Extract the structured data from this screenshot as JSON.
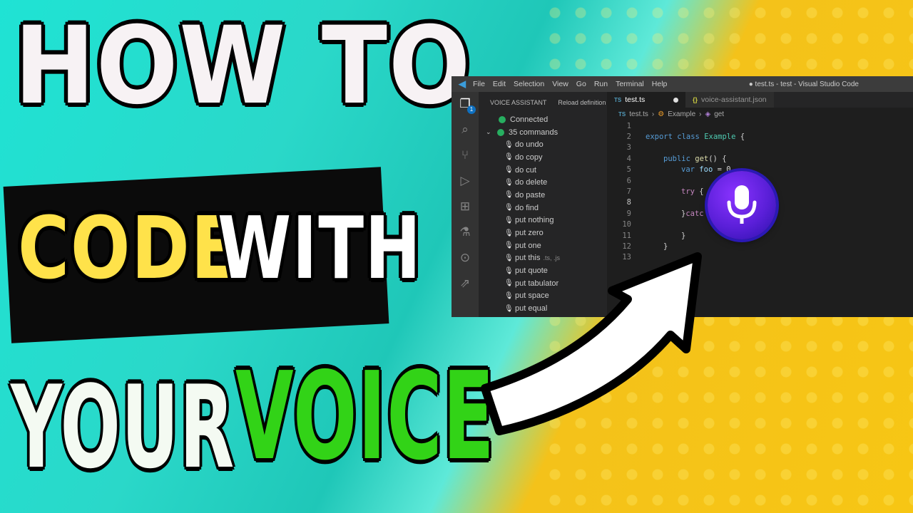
{
  "headline": {
    "line1": "HOW TO",
    "code": "CODE",
    "with": "WITH",
    "your": "YOUR",
    "voice": "VOICE"
  },
  "colors": {
    "teal": "#1fe3d4",
    "yellow": "#f7c614",
    "code_text": "#ffe24a",
    "voice_text": "#32d317",
    "mic_badge": "#6a24e6"
  },
  "vscode": {
    "menu": [
      "File",
      "Edit",
      "Selection",
      "View",
      "Go",
      "Run",
      "Terminal",
      "Help"
    ],
    "window_title": "● test.ts - test - Visual Studio Code",
    "sidebar": {
      "title": "VOICE ASSISTANT",
      "action": "Reload definition",
      "status": "Connected",
      "commands_count": "35 commands",
      "commands": [
        "do undo",
        "do copy",
        "do cut",
        "do delete",
        "do paste",
        "do find",
        "put nothing",
        "put zero",
        "put one",
        "put this",
        "put quote",
        "put tabulator",
        "put space",
        "put equal"
      ],
      "put_this_hint": ".ts, .js"
    },
    "tabs": [
      {
        "label": "test.ts",
        "icon": "TS"
      },
      {
        "label": "voice-assistant.json",
        "icon": "{}"
      }
    ],
    "breadcrumbs": [
      "test.ts",
      "Example",
      "get"
    ],
    "line_numbers": [
      "1",
      "2",
      "3",
      "4",
      "5",
      "6",
      "7",
      "8",
      "9",
      "10",
      "11",
      "12",
      "13"
    ],
    "code_lines": {
      "l2_kw": "export",
      "l2_kw2": "class",
      "l2_cls": "Example",
      "l2_brace": "{",
      "l4_kw": "public",
      "l4_fn": "get",
      "l4_rest": "() {",
      "l5_kw": "var",
      "l5_var": "foo",
      "l5_rest": "= 0",
      "l7_kw": "try",
      "l7_rest": "{",
      "l9_rest": "} ",
      "l9_kw": "catc",
      "l11": "}",
      "l12": "}"
    }
  }
}
